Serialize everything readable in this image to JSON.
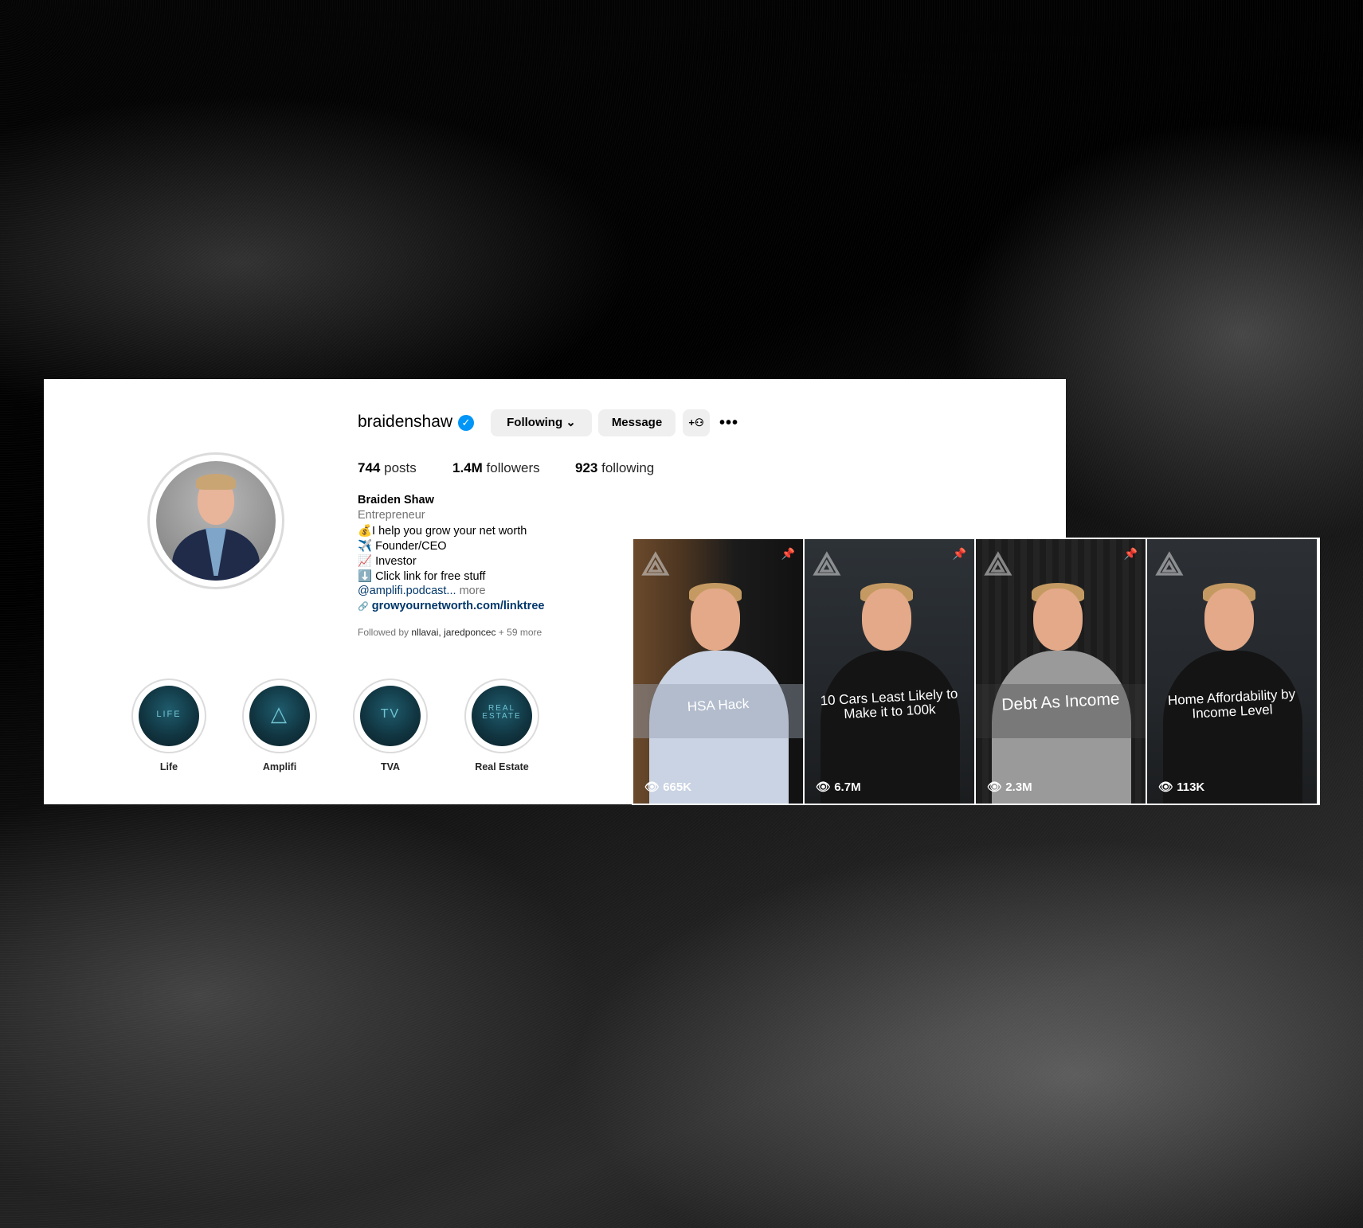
{
  "profile": {
    "username": "braidenshaw",
    "verified_glyph": "✓",
    "buttons": {
      "following": "Following ⌄",
      "message": "Message",
      "add_glyph": "+⚇",
      "more_glyph": "•••"
    },
    "stats": {
      "posts_count": "744",
      "posts_label": "posts",
      "followers_count": "1.4M",
      "followers_label": "followers",
      "following_count": "923",
      "following_label": "following"
    },
    "bio": {
      "name": "Braiden Shaw",
      "category": "Entrepreneur",
      "line1": "💰I help you grow your net worth",
      "line2": "✈️ Founder/CEO",
      "line3": "📈 Investor",
      "line4": "⬇️ Click link for free stuff",
      "link_handle": "@amplifi.podcast...",
      "more": "more",
      "link_glyph": "🔗",
      "website": "growyournetworth.com/linktree"
    },
    "followed_by": {
      "prefix": "Followed by",
      "names": "nllavai, jaredponcec",
      "suffix": "+ 59 more"
    }
  },
  "highlights": [
    {
      "label": "Life",
      "cover_text": "LIFE"
    },
    {
      "label": "Amplifi",
      "cover_text": "△"
    },
    {
      "label": "TVA",
      "cover_text": "TV"
    },
    {
      "label": "Real Estate",
      "cover_text": "REAL ESTATE"
    }
  ],
  "reels": [
    {
      "caption": "HSA Hack",
      "views": "665K",
      "pinned": true
    },
    {
      "caption": "10 Cars Least Likely to Make it to 100k",
      "views": "6.7M",
      "pinned": true
    },
    {
      "caption": "Debt As Income",
      "views": "2.3M",
      "pinned": true
    },
    {
      "caption": "Home Affordability by Income Level",
      "views": "113K",
      "pinned": false
    }
  ],
  "icons": {
    "pin": "📌",
    "eye": "👁",
    "logo": "⟁"
  }
}
